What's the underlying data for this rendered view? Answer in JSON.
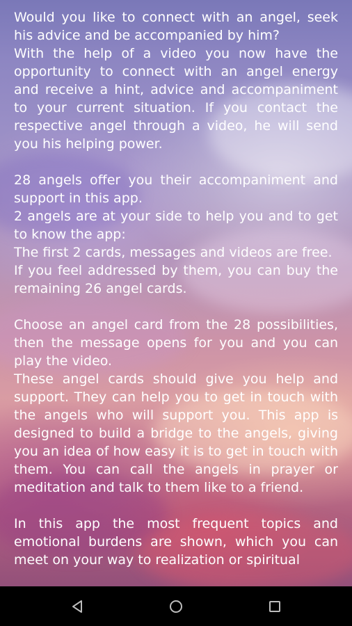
{
  "content": {
    "paragraphs": [
      "Would you like to connect with an angel, seek his advice and be accompanied by him?",
      "With the help of a video you now have the opportunity to connect with an angel energy and receive a hint, advice and accompaniment to your current situation. If you contact the respective angel through a video, he will send you his helping power.",
      "",
      "28 angels offer you their accompaniment and support in this app.",
      "2 angels are at your side to help you and to get to know the app:",
      "The first 2 cards, messages and videos are free.",
      "If you feel addressed by them, you can buy the remaining 26 angel cards.",
      "",
      "Choose an angel card from the 28 possibilities, then the message opens for you and you can play the video.",
      "These angel cards should give you help and support. They can help you to get in touch with the angels who will support you. This app is designed to build a bridge to the angels, giving you an idea of how easy it is to get in touch with them. You can call the angels in prayer or meditation and talk to them like to a friend.",
      "",
      "In this app the most frequent topics and emotional burdens are shown, which you can meet on your way to realization or spiritual"
    ]
  },
  "navbar": {
    "back": "back-icon",
    "home": "home-icon",
    "recents": "recents-icon"
  },
  "colors": {
    "text": "#ffffff",
    "navbar": "#000000",
    "nav_icon": "#bdbdbd"
  }
}
